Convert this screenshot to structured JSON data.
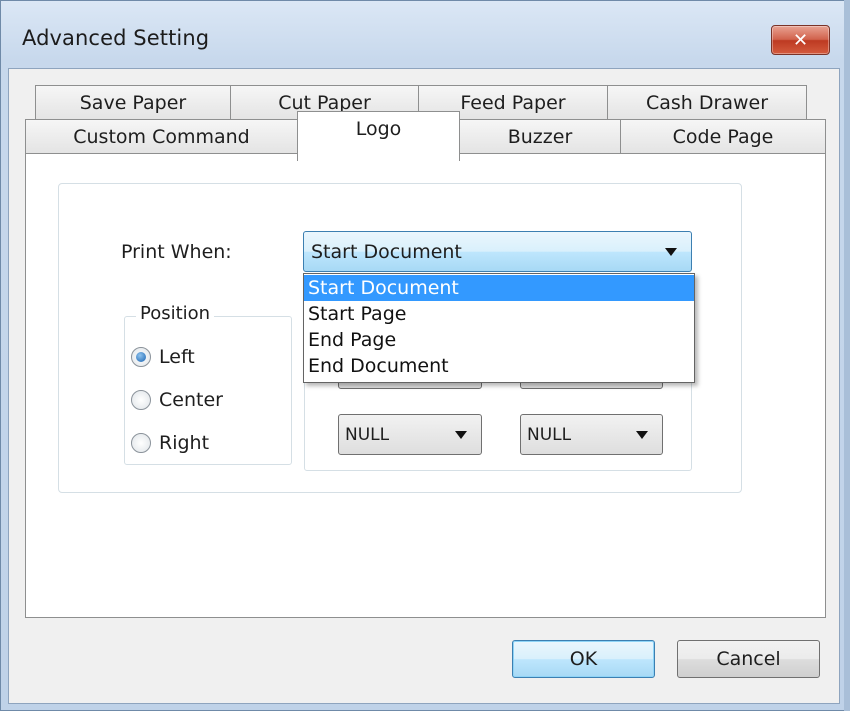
{
  "window": {
    "title": "Advanced Setting",
    "close_glyph": "✕"
  },
  "tabs": {
    "row_top": [
      {
        "label": "Save Paper"
      },
      {
        "label": "Cut Paper"
      },
      {
        "label": "Feed Paper"
      },
      {
        "label": "Cash Drawer"
      }
    ],
    "row_bottom": [
      {
        "label": "Custom Command"
      },
      {
        "label": "Logo"
      },
      {
        "label": "Buzzer"
      },
      {
        "label": "Code Page"
      }
    ],
    "selected": "Logo"
  },
  "logo_page": {
    "print_when_label": "Print When:",
    "print_when_value": "Start Document",
    "dropdown_options": [
      "Start Document",
      "Start Page",
      "End Page",
      "End Document"
    ],
    "dropdown_selected": "Start Document",
    "position_label": "Position",
    "position_options": [
      {
        "label": "Left",
        "checked": true
      },
      {
        "label": "Center",
        "checked": false
      },
      {
        "label": "Right",
        "checked": false
      }
    ],
    "combo_left_value": "NULL",
    "combo_right_value": "NULL"
  },
  "buttons": {
    "ok": "OK",
    "cancel": "Cancel"
  },
  "colors": {
    "selection": "#3399ff",
    "close_button": "#c9452e",
    "focus_border": "#3c7fb1"
  }
}
